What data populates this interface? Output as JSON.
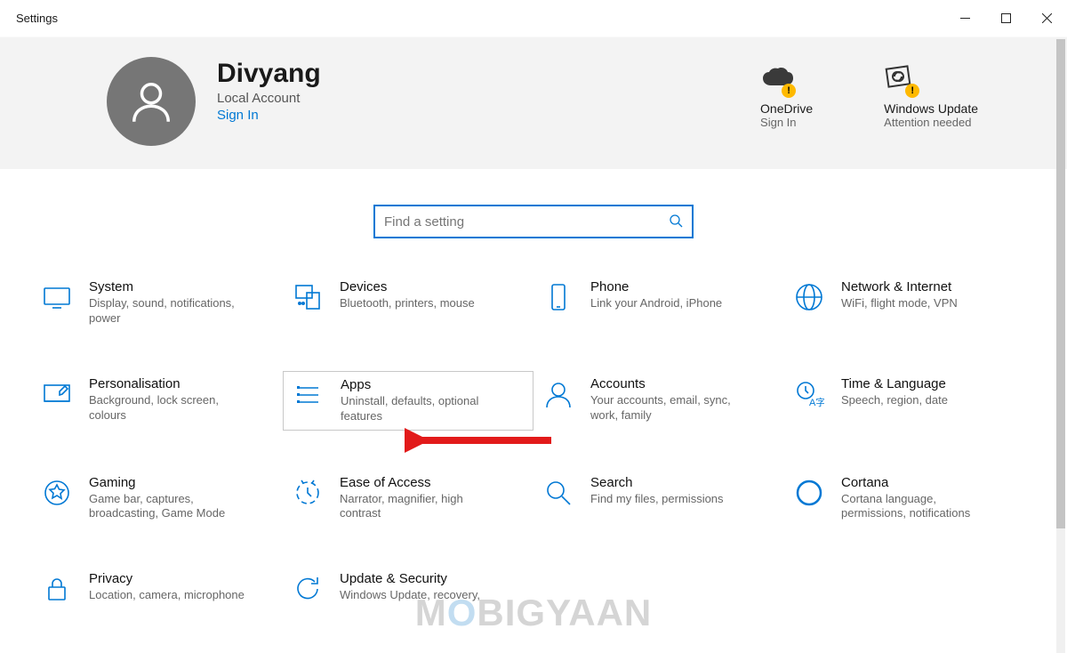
{
  "window": {
    "title": "Settings"
  },
  "user": {
    "name": "Divyang",
    "account_type": "Local Account",
    "signin_label": "Sign In"
  },
  "header_cards": {
    "onedrive": {
      "title": "OneDrive",
      "sub": "Sign In"
    },
    "update": {
      "title": "Windows Update",
      "sub": "Attention needed"
    }
  },
  "search": {
    "placeholder": "Find a setting"
  },
  "categories": [
    {
      "id": "system",
      "title": "System",
      "desc": "Display, sound, notifications, power"
    },
    {
      "id": "devices",
      "title": "Devices",
      "desc": "Bluetooth, printers, mouse"
    },
    {
      "id": "phone",
      "title": "Phone",
      "desc": "Link your Android, iPhone"
    },
    {
      "id": "network",
      "title": "Network & Internet",
      "desc": "WiFi, flight mode, VPN"
    },
    {
      "id": "personalisation",
      "title": "Personalisation",
      "desc": "Background, lock screen, colours"
    },
    {
      "id": "apps",
      "title": "Apps",
      "desc": "Uninstall, defaults, optional features",
      "highlighted": true
    },
    {
      "id": "accounts",
      "title": "Accounts",
      "desc": "Your accounts, email, sync, work, family"
    },
    {
      "id": "time",
      "title": "Time & Language",
      "desc": "Speech, region, date"
    },
    {
      "id": "gaming",
      "title": "Gaming",
      "desc": "Game bar, captures, broadcasting, Game Mode"
    },
    {
      "id": "ease",
      "title": "Ease of Access",
      "desc": "Narrator, magnifier, high contrast"
    },
    {
      "id": "search",
      "title": "Search",
      "desc": "Find my files, permissions"
    },
    {
      "id": "cortana",
      "title": "Cortana",
      "desc": "Cortana language, permissions, notifications"
    },
    {
      "id": "privacy",
      "title": "Privacy",
      "desc": "Location, camera, microphone"
    },
    {
      "id": "update",
      "title": "Update & Security",
      "desc": "Windows Update, recovery,"
    }
  ],
  "watermark": "MOBIGYAAN"
}
